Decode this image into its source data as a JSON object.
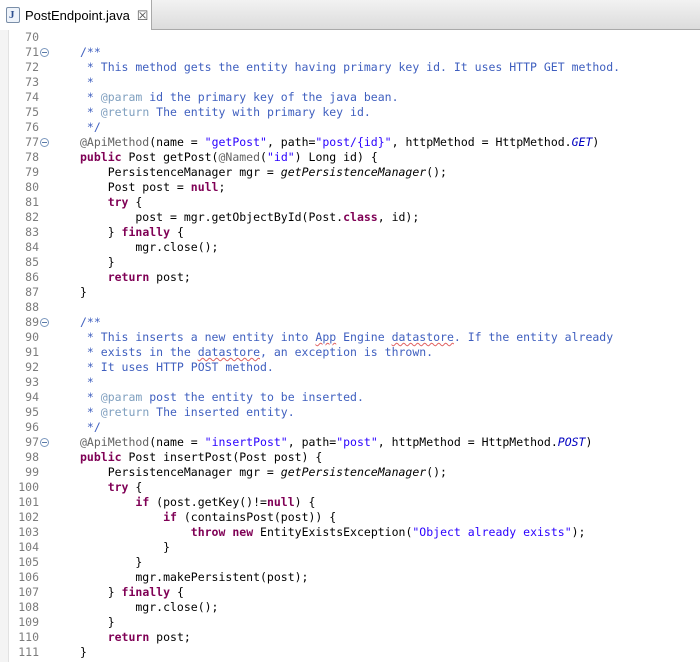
{
  "editor_tab": {
    "title": "PostEndpoint.java",
    "close_glyph": "☒",
    "icon": "java-file-icon"
  },
  "colors": {
    "comment": "#3f5fbf",
    "javadoc_tag": "#7f9fbf",
    "keyword": "#7f0055",
    "string": "#2a00ff",
    "static_field": "#0000c0",
    "annotation": "#646464",
    "line_number": "#7c7c7c"
  },
  "lines": [
    {
      "num": "70",
      "fold": false,
      "tokens": []
    },
    {
      "num": "71",
      "fold": true,
      "tokens": [
        {
          "t": "/**",
          "c": "c"
        }
      ]
    },
    {
      "num": "72",
      "fold": false,
      "tokens": [
        {
          "t": " * This method gets the entity having primary key id. It uses HTTP GET method.",
          "c": "c"
        }
      ]
    },
    {
      "num": "73",
      "fold": false,
      "tokens": [
        {
          "t": " *",
          "c": "c"
        }
      ]
    },
    {
      "num": "74",
      "fold": false,
      "tokens": [
        {
          "t": " * ",
          "c": "c"
        },
        {
          "t": "@param",
          "c": "d"
        },
        {
          "t": " id the primary key of the java bean.",
          "c": "c"
        }
      ]
    },
    {
      "num": "75",
      "fold": false,
      "tokens": [
        {
          "t": " * ",
          "c": "c"
        },
        {
          "t": "@return",
          "c": "d"
        },
        {
          "t": " The entity with primary key id.",
          "c": "c"
        }
      ]
    },
    {
      "num": "76",
      "fold": false,
      "tokens": [
        {
          "t": " */",
          "c": "c"
        }
      ]
    },
    {
      "num": "77",
      "fold": true,
      "tokens": [
        {
          "t": "@ApiMethod",
          "c": "a"
        },
        {
          "t": "(name = ",
          "c": "n"
        },
        {
          "t": "\"getPost\"",
          "c": "s"
        },
        {
          "t": ", path=",
          "c": "n"
        },
        {
          "t": "\"post/{id}\"",
          "c": "s"
        },
        {
          "t": ", httpMethod = HttpMethod.",
          "c": "n"
        },
        {
          "t": "GET",
          "c": "f"
        },
        {
          "t": ")",
          "c": "n"
        }
      ]
    },
    {
      "num": "78",
      "fold": false,
      "tokens": [
        {
          "t": "public",
          "c": "k"
        },
        {
          "t": " Post getPost(",
          "c": "n"
        },
        {
          "t": "@Named",
          "c": "a"
        },
        {
          "t": "(",
          "c": "n"
        },
        {
          "t": "\"id\"",
          "c": "s"
        },
        {
          "t": ") Long id) {",
          "c": "n"
        }
      ]
    },
    {
      "num": "79",
      "fold": false,
      "tokens": [
        {
          "t": "    PersistenceManager mgr = ",
          "c": "n"
        },
        {
          "t": "getPersistenceManager",
          "c": "m"
        },
        {
          "t": "();",
          "c": "n"
        }
      ]
    },
    {
      "num": "80",
      "fold": false,
      "tokens": [
        {
          "t": "    Post post = ",
          "c": "n"
        },
        {
          "t": "null",
          "c": "k"
        },
        {
          "t": ";",
          "c": "n"
        }
      ]
    },
    {
      "num": "81",
      "fold": false,
      "tokens": [
        {
          "t": "    ",
          "c": "n"
        },
        {
          "t": "try",
          "c": "k"
        },
        {
          "t": " {",
          "c": "n"
        }
      ]
    },
    {
      "num": "82",
      "fold": false,
      "tokens": [
        {
          "t": "        post = mgr.getObjectById(Post.",
          "c": "n"
        },
        {
          "t": "class",
          "c": "k"
        },
        {
          "t": ", id);",
          "c": "n"
        }
      ]
    },
    {
      "num": "83",
      "fold": false,
      "tokens": [
        {
          "t": "    } ",
          "c": "n"
        },
        {
          "t": "finally",
          "c": "k"
        },
        {
          "t": " {",
          "c": "n"
        }
      ]
    },
    {
      "num": "84",
      "fold": false,
      "tokens": [
        {
          "t": "        mgr.close();",
          "c": "n"
        }
      ]
    },
    {
      "num": "85",
      "fold": false,
      "tokens": [
        {
          "t": "    }",
          "c": "n"
        }
      ]
    },
    {
      "num": "86",
      "fold": false,
      "tokens": [
        {
          "t": "    ",
          "c": "n"
        },
        {
          "t": "return",
          "c": "k"
        },
        {
          "t": " post;",
          "c": "n"
        }
      ]
    },
    {
      "num": "87",
      "fold": false,
      "tokens": [
        {
          "t": "}",
          "c": "n"
        }
      ]
    },
    {
      "num": "88",
      "fold": false,
      "tokens": []
    },
    {
      "num": "89",
      "fold": true,
      "tokens": [
        {
          "t": "/**",
          "c": "c"
        }
      ]
    },
    {
      "num": "90",
      "fold": false,
      "tokens": [
        {
          "t": " * This inserts a new entity into ",
          "c": "c"
        },
        {
          "t": "App",
          "c": "c sq"
        },
        {
          "t": " Engine ",
          "c": "c"
        },
        {
          "t": "datastore",
          "c": "c sq"
        },
        {
          "t": ". If the entity already",
          "c": "c"
        }
      ]
    },
    {
      "num": "91",
      "fold": false,
      "tokens": [
        {
          "t": " * exists in the ",
          "c": "c"
        },
        {
          "t": "datastore",
          "c": "c sq"
        },
        {
          "t": ", an exception is thrown.",
          "c": "c"
        }
      ]
    },
    {
      "num": "92",
      "fold": false,
      "tokens": [
        {
          "t": " * It uses HTTP POST method.",
          "c": "c"
        }
      ]
    },
    {
      "num": "93",
      "fold": false,
      "tokens": [
        {
          "t": " *",
          "c": "c"
        }
      ]
    },
    {
      "num": "94",
      "fold": false,
      "tokens": [
        {
          "t": " * ",
          "c": "c"
        },
        {
          "t": "@param",
          "c": "d"
        },
        {
          "t": " post the entity to be inserted.",
          "c": "c"
        }
      ]
    },
    {
      "num": "95",
      "fold": false,
      "tokens": [
        {
          "t": " * ",
          "c": "c"
        },
        {
          "t": "@return",
          "c": "d"
        },
        {
          "t": " The inserted entity.",
          "c": "c"
        }
      ]
    },
    {
      "num": "96",
      "fold": false,
      "tokens": [
        {
          "t": " */",
          "c": "c"
        }
      ]
    },
    {
      "num": "97",
      "fold": true,
      "tokens": [
        {
          "t": "@ApiMethod",
          "c": "a"
        },
        {
          "t": "(name = ",
          "c": "n"
        },
        {
          "t": "\"insertPost\"",
          "c": "s"
        },
        {
          "t": ", path=",
          "c": "n"
        },
        {
          "t": "\"post\"",
          "c": "s"
        },
        {
          "t": ", httpMethod = HttpMethod.",
          "c": "n"
        },
        {
          "t": "POST",
          "c": "f"
        },
        {
          "t": ")",
          "c": "n"
        }
      ]
    },
    {
      "num": "98",
      "fold": false,
      "tokens": [
        {
          "t": "public",
          "c": "k"
        },
        {
          "t": " Post insertPost(Post post) {",
          "c": "n"
        }
      ]
    },
    {
      "num": "99",
      "fold": false,
      "tokens": [
        {
          "t": "    PersistenceManager mgr = ",
          "c": "n"
        },
        {
          "t": "getPersistenceManager",
          "c": "m"
        },
        {
          "t": "();",
          "c": "n"
        }
      ]
    },
    {
      "num": "100",
      "fold": false,
      "tokens": [
        {
          "t": "    ",
          "c": "n"
        },
        {
          "t": "try",
          "c": "k"
        },
        {
          "t": " {",
          "c": "n"
        }
      ]
    },
    {
      "num": "101",
      "fold": false,
      "tokens": [
        {
          "t": "        ",
          "c": "n"
        },
        {
          "t": "if",
          "c": "k"
        },
        {
          "t": " (post.getKey()!=",
          "c": "n"
        },
        {
          "t": "null",
          "c": "k"
        },
        {
          "t": ") {",
          "c": "n"
        }
      ]
    },
    {
      "num": "102",
      "fold": false,
      "tokens": [
        {
          "t": "            ",
          "c": "n"
        },
        {
          "t": "if",
          "c": "k"
        },
        {
          "t": " (containsPost(post)) {",
          "c": "n"
        }
      ]
    },
    {
      "num": "103",
      "fold": false,
      "tokens": [
        {
          "t": "                ",
          "c": "n"
        },
        {
          "t": "throw",
          "c": "k"
        },
        {
          "t": " ",
          "c": "n"
        },
        {
          "t": "new",
          "c": "k"
        },
        {
          "t": " EntityExistsException(",
          "c": "n"
        },
        {
          "t": "\"Object already exists\"",
          "c": "s"
        },
        {
          "t": ");",
          "c": "n"
        }
      ]
    },
    {
      "num": "104",
      "fold": false,
      "tokens": [
        {
          "t": "            }",
          "c": "n"
        }
      ]
    },
    {
      "num": "105",
      "fold": false,
      "tokens": [
        {
          "t": "        }",
          "c": "n"
        }
      ]
    },
    {
      "num": "106",
      "fold": false,
      "tokens": [
        {
          "t": "        mgr.makePersistent(post);",
          "c": "n"
        }
      ]
    },
    {
      "num": "107",
      "fold": false,
      "tokens": [
        {
          "t": "    } ",
          "c": "n"
        },
        {
          "t": "finally",
          "c": "k"
        },
        {
          "t": " {",
          "c": "n"
        }
      ]
    },
    {
      "num": "108",
      "fold": false,
      "tokens": [
        {
          "t": "        mgr.close();",
          "c": "n"
        }
      ]
    },
    {
      "num": "109",
      "fold": false,
      "tokens": [
        {
          "t": "    }",
          "c": "n"
        }
      ]
    },
    {
      "num": "110",
      "fold": false,
      "tokens": [
        {
          "t": "    ",
          "c": "n"
        },
        {
          "t": "return",
          "c": "k"
        },
        {
          "t": " post;",
          "c": "n"
        }
      ]
    },
    {
      "num": "111",
      "fold": false,
      "tokens": [
        {
          "t": "}",
          "c": "n"
        }
      ]
    }
  ]
}
